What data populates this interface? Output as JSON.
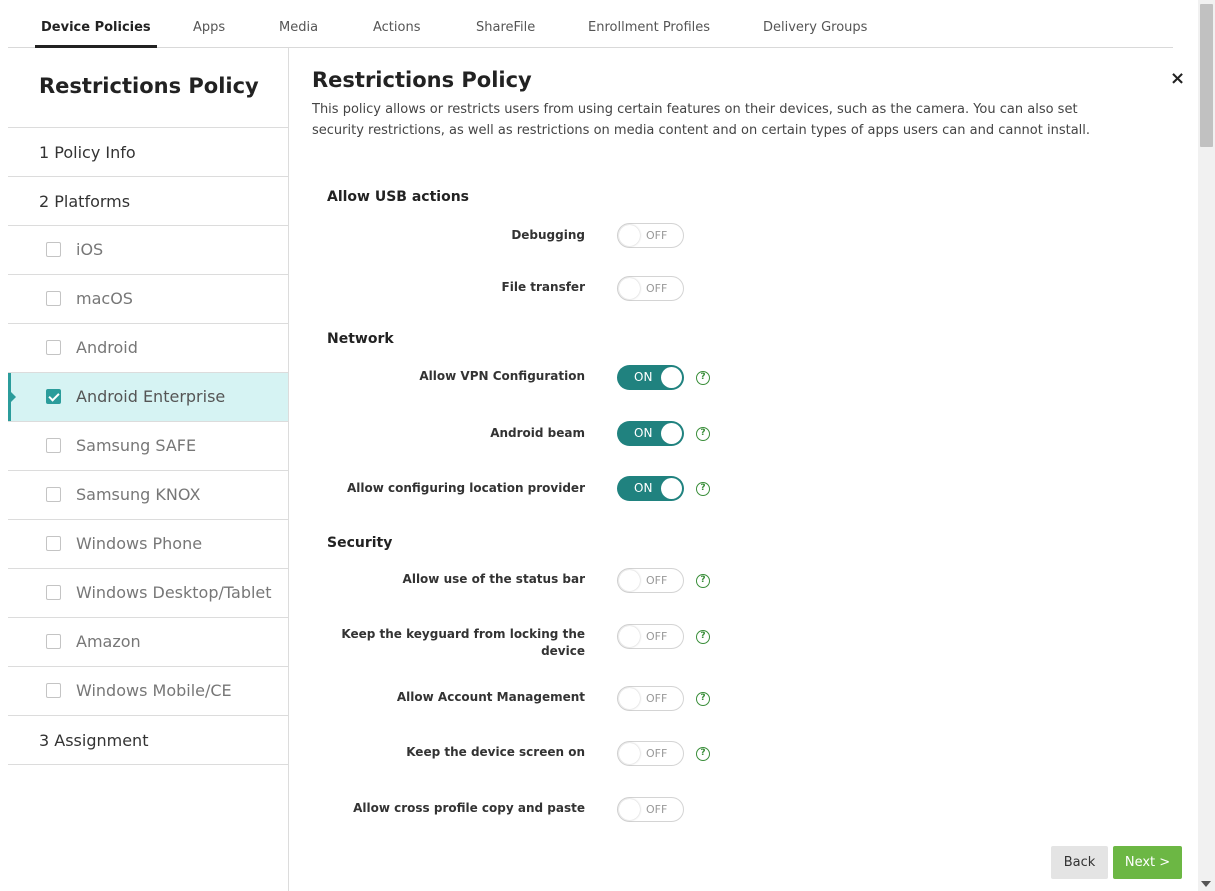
{
  "tabs": [
    "Device Policies",
    "Apps",
    "Media",
    "Actions",
    "ShareFile",
    "Enrollment Profiles",
    "Delivery Groups"
  ],
  "sidebar": {
    "title": "Restrictions Policy",
    "step1": "1  Policy Info",
    "step2": "2  Platforms",
    "platforms": [
      "iOS",
      "macOS",
      "Android",
      "Android Enterprise",
      "Samsung SAFE",
      "Samsung KNOX",
      "Windows Phone",
      "Windows Desktop/Tablet",
      "Amazon",
      "Windows Mobile/CE"
    ],
    "selected_platform": "Android Enterprise",
    "step3": "3  Assignment"
  },
  "main": {
    "title": "Restrictions Policy",
    "close": "×",
    "description": "This policy allows or restricts users from using certain features on their devices, such as the camera. You can also set security restrictions, as well as restrictions on media content and on certain types of apps users can and cannot install.",
    "sections": {
      "usb": "Allow USB actions",
      "network": "Network",
      "security": "Security"
    },
    "settings": {
      "debugging": {
        "label": "Debugging",
        "state": "OFF"
      },
      "file_transfer": {
        "label": "File transfer",
        "state": "OFF"
      },
      "vpn": {
        "label": "Allow VPN Configuration",
        "state": "ON"
      },
      "beam": {
        "label": "Android beam",
        "state": "ON"
      },
      "location": {
        "label": "Allow configuring location provider",
        "state": "ON"
      },
      "status_bar": {
        "label": "Allow use of the status bar",
        "state": "OFF"
      },
      "keyguard": {
        "label": "Keep the keyguard from locking the device",
        "state": "OFF"
      },
      "account_mgmt": {
        "label": "Allow Account Management",
        "state": "OFF"
      },
      "screen_on": {
        "label": "Keep the device screen on",
        "state": "OFF"
      },
      "copy_paste": {
        "label": "Allow cross profile copy and paste",
        "state": "OFF"
      }
    },
    "help_glyph": "?"
  },
  "buttons": {
    "back": "Back",
    "next": "Next >"
  },
  "colors": {
    "toggle_on": "#20827f",
    "selected_bg": "#d6f3f3",
    "next_button": "#6cb744",
    "help": "#3a8e3a"
  }
}
